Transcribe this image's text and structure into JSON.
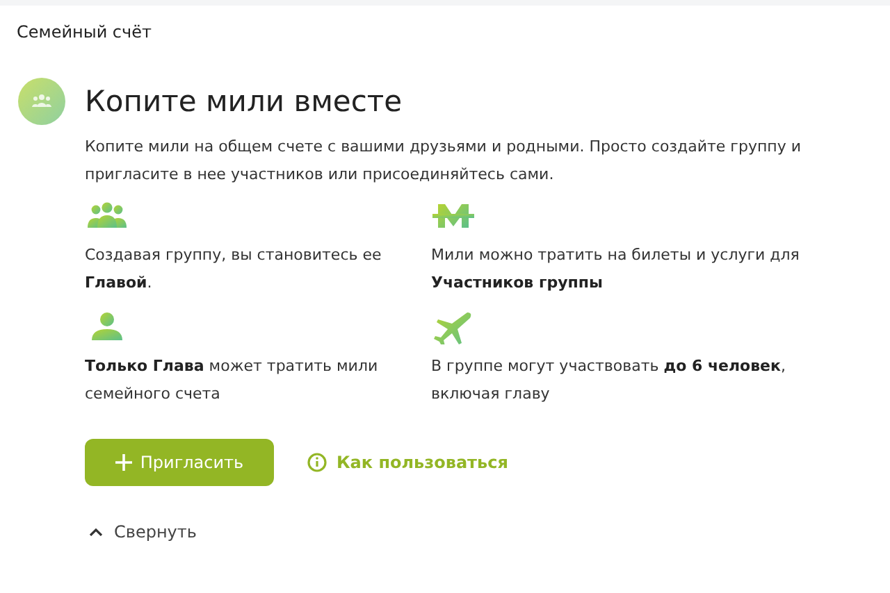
{
  "header": {
    "title": "Семейный счёт"
  },
  "intro": {
    "title": "Копите мили вместе",
    "description": "Копите мили на общем счете с вашими друзьями и родными. Просто создайте группу и пригласите в нее участников или присоединяйтесь сами."
  },
  "features": [
    {
      "kind": "group",
      "text": "Создавая группу, вы становитесь ее **Главой**."
    },
    {
      "kind": "miles",
      "text": "Мили можно тратить на билеты и услуги для **Участников группы**"
    },
    {
      "kind": "person",
      "text": "**Только Глава** может тратить мили семейного счета"
    },
    {
      "kind": "plane",
      "text": "В группе могут участвовать **до 6 человек**, включая главу"
    }
  ],
  "actions": {
    "primary": "Пригласить",
    "help_link": "Как пользоваться"
  },
  "collapse": {
    "label": "Свернуть"
  }
}
